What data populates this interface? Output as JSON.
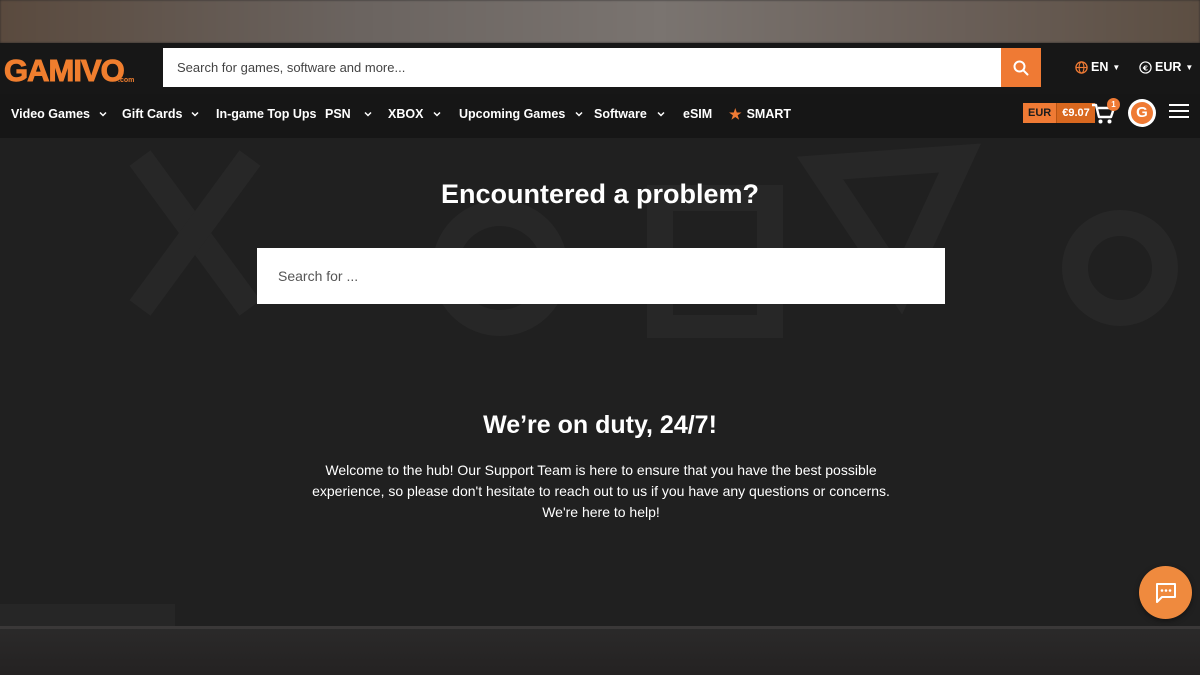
{
  "header": {
    "logo_text": "GAMIVO",
    "logo_sub": ".com",
    "search_placeholder": "Search for games, software and more...",
    "language": "EN",
    "currency": "EUR",
    "search_icon": "search-icon",
    "globe_icon": "globe-icon",
    "euro_icon": "euro-icon"
  },
  "nav": {
    "items": [
      {
        "label": "Video Games",
        "has_dropdown": true
      },
      {
        "label": "Gift Cards",
        "has_dropdown": true
      },
      {
        "label": "In-game Top Ups",
        "has_dropdown": false
      },
      {
        "label": "PSN",
        "has_dropdown": true
      },
      {
        "label": "XBOX",
        "has_dropdown": true
      },
      {
        "label": "Upcoming Games",
        "has_dropdown": true
      },
      {
        "label": "Software",
        "has_dropdown": true
      },
      {
        "label": "eSIM",
        "has_dropdown": false
      },
      {
        "label": "SMART",
        "has_dropdown": false,
        "icon": "star-icon"
      }
    ],
    "wallet_currency": "EUR",
    "wallet_amount": "€9.07",
    "cart_count": "1",
    "avatar_letter": "G"
  },
  "hero": {
    "title": "Encountered a problem?",
    "search_placeholder": "Search for ..."
  },
  "support": {
    "title": "We’re on duty, 24/7!",
    "text": "Welcome to the hub! Our Support Team is here to ensure that you have the best possible experience, so please don't hesitate to reach out to us if you have any questions or concerns. We're here to help!"
  },
  "chat": {
    "icon": "chat-icon"
  },
  "colors": {
    "accent": "#ef7a34",
    "header_bg": "#171717",
    "page_bg": "#202020"
  }
}
